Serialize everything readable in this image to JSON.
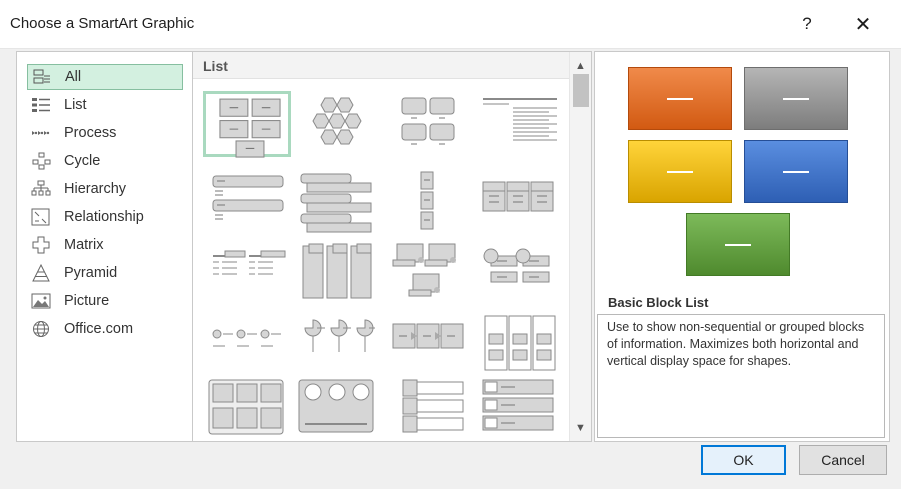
{
  "window": {
    "title": "Choose a SmartArt Graphic",
    "help": "?",
    "close": "✕"
  },
  "categories": [
    {
      "label": "All",
      "icon": "all-icon",
      "selected": true
    },
    {
      "label": "List",
      "icon": "list-icon"
    },
    {
      "label": "Process",
      "icon": "process-icon"
    },
    {
      "label": "Cycle",
      "icon": "cycle-icon"
    },
    {
      "label": "Hierarchy",
      "icon": "hierarchy-icon"
    },
    {
      "label": "Relationship",
      "icon": "relationship-icon"
    },
    {
      "label": "Matrix",
      "icon": "matrix-icon"
    },
    {
      "label": "Pyramid",
      "icon": "pyramid-icon"
    },
    {
      "label": "Picture",
      "icon": "picture-icon"
    },
    {
      "label": "Office.com",
      "icon": "globe-icon"
    }
  ],
  "gallery": {
    "section": "List",
    "selected_index": 0
  },
  "preview": {
    "title": "Basic Block List",
    "description": "Use to show non-sequential or grouped blocks of information. Maximizes both horizontal and vertical display space for shapes."
  },
  "buttons": {
    "ok": "OK",
    "cancel": "Cancel"
  },
  "colors": {
    "selection": "#d3f0e0",
    "accent": "#0078d7"
  }
}
